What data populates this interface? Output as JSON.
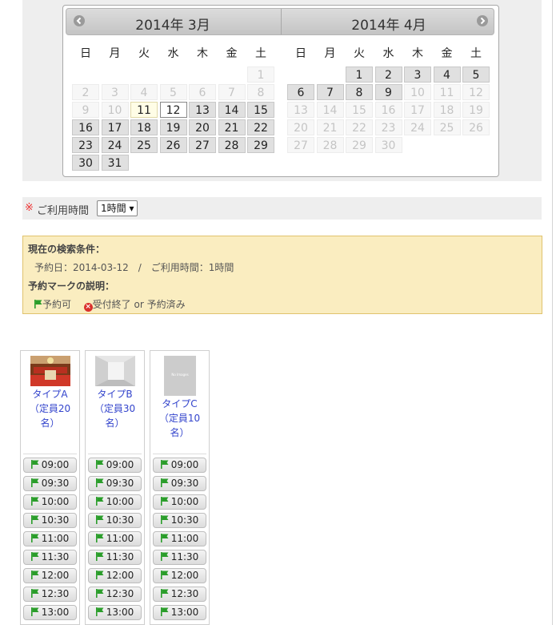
{
  "calendar": {
    "left_title": "2014年 3月",
    "right_title": "2014年 4月",
    "weekdays": [
      "日",
      "月",
      "火",
      "水",
      "木",
      "金",
      "土"
    ],
    "march": {
      "rows": [
        [
          [
            "",
            ""
          ],
          [
            "",
            ""
          ],
          [
            "",
            ""
          ],
          [
            "",
            ""
          ],
          [
            "",
            ""
          ],
          [
            "",
            ""
          ],
          [
            "1",
            "off"
          ]
        ],
        [
          [
            "2",
            "off"
          ],
          [
            "3",
            "off"
          ],
          [
            "4",
            "off"
          ],
          [
            "5",
            "off"
          ],
          [
            "6",
            "off"
          ],
          [
            "7",
            "off"
          ],
          [
            "8",
            "off"
          ]
        ],
        [
          [
            "9",
            "off"
          ],
          [
            "10",
            "off"
          ],
          [
            "11",
            "today"
          ],
          [
            "12",
            "sel"
          ],
          [
            "13",
            "on"
          ],
          [
            "14",
            "on"
          ],
          [
            "15",
            "on"
          ]
        ],
        [
          [
            "16",
            "on"
          ],
          [
            "17",
            "on"
          ],
          [
            "18",
            "on"
          ],
          [
            "19",
            "on"
          ],
          [
            "20",
            "on"
          ],
          [
            "21",
            "on"
          ],
          [
            "22",
            "on"
          ]
        ],
        [
          [
            "23",
            "on"
          ],
          [
            "24",
            "on"
          ],
          [
            "25",
            "on"
          ],
          [
            "26",
            "on"
          ],
          [
            "27",
            "on"
          ],
          [
            "28",
            "on"
          ],
          [
            "29",
            "on"
          ]
        ],
        [
          [
            "30",
            "on"
          ],
          [
            "31",
            "on"
          ],
          [
            "",
            ""
          ],
          [
            "",
            ""
          ],
          [
            "",
            ""
          ],
          [
            "",
            ""
          ],
          [
            "",
            ""
          ]
        ]
      ]
    },
    "april": {
      "rows": [
        [
          [
            "",
            ""
          ],
          [
            "",
            ""
          ],
          [
            "1",
            "on"
          ],
          [
            "2",
            "on"
          ],
          [
            "3",
            "on"
          ],
          [
            "4",
            "on"
          ],
          [
            "5",
            "on"
          ]
        ],
        [
          [
            "6",
            "on"
          ],
          [
            "7",
            "on"
          ],
          [
            "8",
            "on"
          ],
          [
            "9",
            "on"
          ],
          [
            "10",
            "off"
          ],
          [
            "11",
            "off"
          ],
          [
            "12",
            "off"
          ]
        ],
        [
          [
            "13",
            "off"
          ],
          [
            "14",
            "off"
          ],
          [
            "15",
            "off"
          ],
          [
            "16",
            "off"
          ],
          [
            "17",
            "off"
          ],
          [
            "18",
            "off"
          ],
          [
            "19",
            "off"
          ]
        ],
        [
          [
            "20",
            "off"
          ],
          [
            "21",
            "off"
          ],
          [
            "22",
            "off"
          ],
          [
            "23",
            "off"
          ],
          [
            "24",
            "off"
          ],
          [
            "25",
            "off"
          ],
          [
            "26",
            "off"
          ]
        ],
        [
          [
            "27",
            "off"
          ],
          [
            "28",
            "off"
          ],
          [
            "29",
            "off"
          ],
          [
            "30",
            "off"
          ],
          [
            "",
            ""
          ],
          [
            "",
            ""
          ],
          [
            "",
            ""
          ]
        ]
      ]
    }
  },
  "time_bar": {
    "required_mark": "※",
    "label": "ご利用時間",
    "selected": "1時間 ▾"
  },
  "info": {
    "cond_heading": "現在の検索条件：",
    "cond_text": "予約日：2014-03-12　/　ご利用時間：1時間",
    "legend_heading": "予約マークの説明：",
    "legend_available": "予約可",
    "legend_unavailable": "受付終了 or 予約済み"
  },
  "rooms": [
    {
      "name_lines": [
        "タイプA",
        "（定員20",
        "名）"
      ],
      "thumb": "hall"
    },
    {
      "name_lines": [
        "タイプB",
        "（定員30",
        "名）"
      ],
      "thumb": "room"
    },
    {
      "name_lines": [
        "タイプC",
        "（定員10",
        "名）"
      ],
      "thumb": "noimage"
    }
  ],
  "no_image_text": "No Images",
  "slots": [
    "09:00",
    "09:30",
    "10:00",
    "10:30",
    "11:00",
    "11:30",
    "12:00",
    "12:30",
    "13:00"
  ],
  "colors": {
    "flag_green": "#2a9d2a",
    "mark_red": "#d9302c",
    "link_blue": "#3344cc"
  }
}
